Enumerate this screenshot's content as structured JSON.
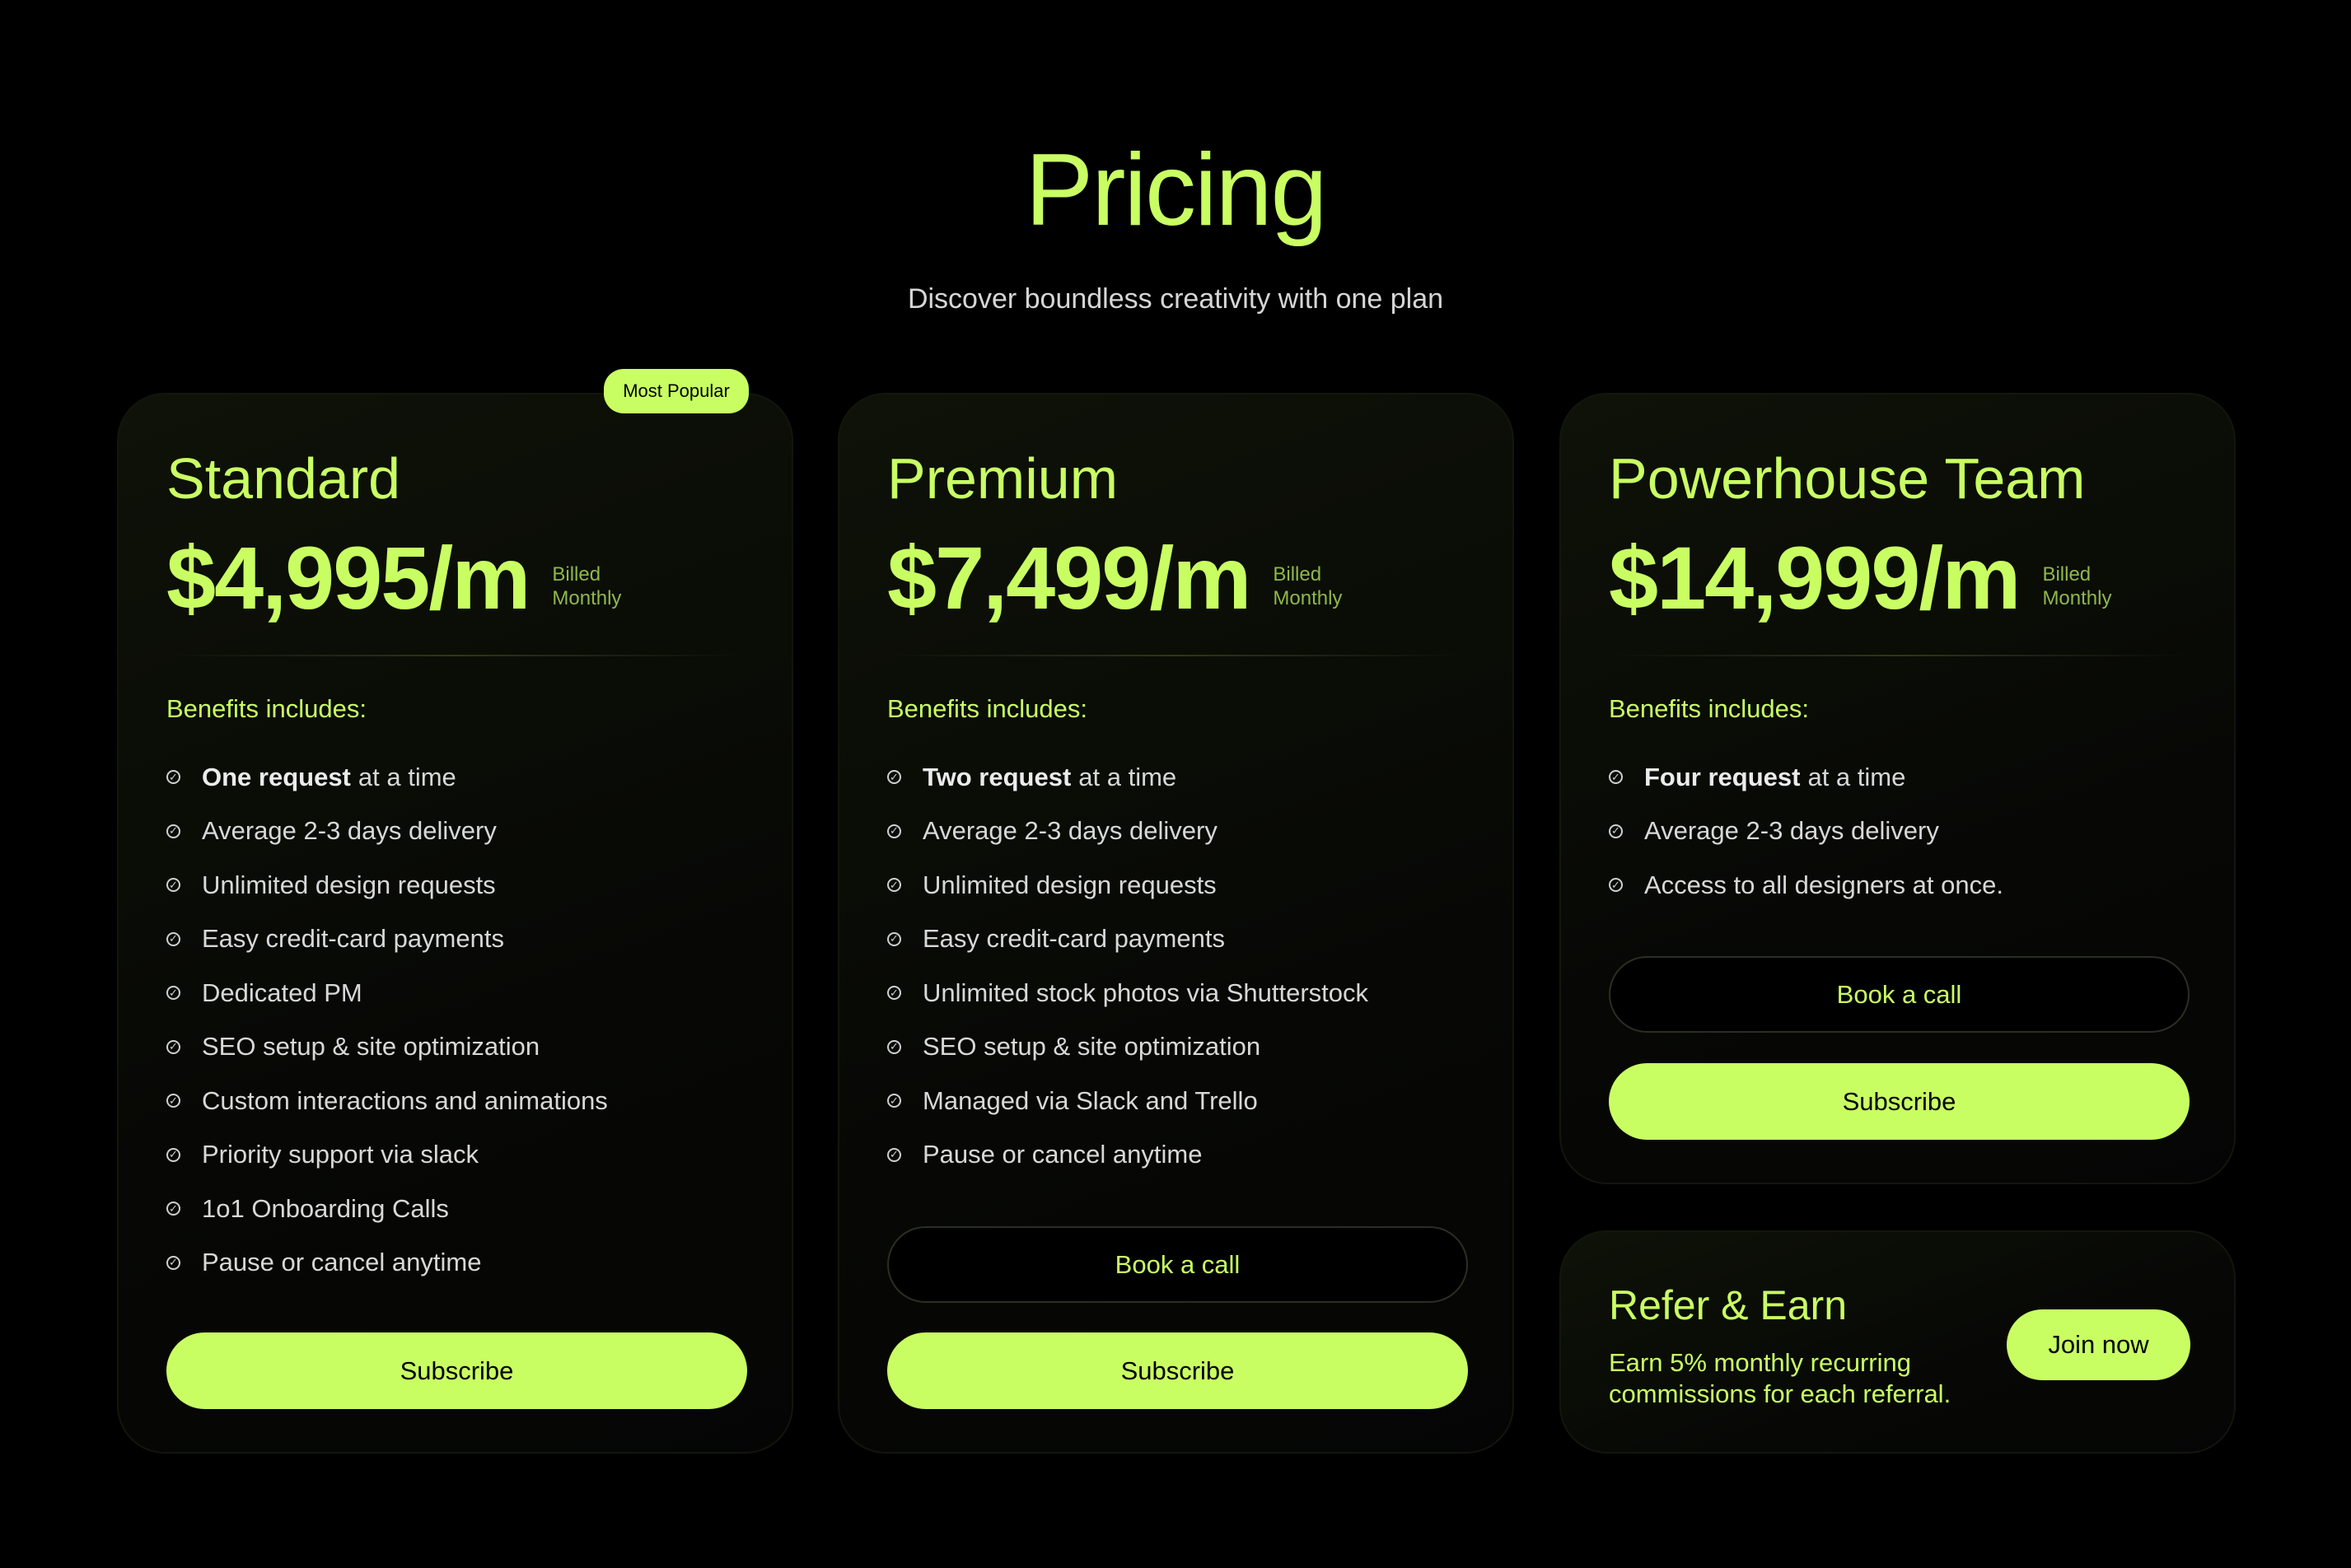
{
  "header": {
    "title": "Pricing",
    "subtitle": "Discover boundless creativity with one plan"
  },
  "colors": {
    "accent": "#c9fe63",
    "background": "#000000"
  },
  "plans": [
    {
      "name": "Standard",
      "price": "$4,995/m",
      "billed_line1": "Billed",
      "billed_line2": "Monthly",
      "badge": "Most Popular",
      "benefits_label": "Benefits includes:",
      "benefits": [
        {
          "bold": "One request",
          "text": "at a time"
        },
        {
          "bold": "",
          "text": "Average 2-3 days delivery"
        },
        {
          "bold": "",
          "text": "Unlimited design requests"
        },
        {
          "bold": "",
          "text": "Easy credit-card payments"
        },
        {
          "bold": "",
          "text": "Dedicated PM"
        },
        {
          "bold": "",
          "text": "SEO setup & site optimization"
        },
        {
          "bold": "",
          "text": "Custom interactions and animations"
        },
        {
          "bold": "",
          "text": "Priority support via slack"
        },
        {
          "bold": "",
          "text": "1o1 Onboarding Calls"
        },
        {
          "bold": "",
          "text": "Pause or cancel anytime"
        }
      ],
      "subscribe_label": "Subscribe"
    },
    {
      "name": "Premium",
      "price": "$7,499/m",
      "billed_line1": "Billed",
      "billed_line2": "Monthly",
      "benefits_label": "Benefits includes:",
      "benefits": [
        {
          "bold": "Two request",
          "text": "at a time"
        },
        {
          "bold": "",
          "text": "Average 2-3 days delivery"
        },
        {
          "bold": "",
          "text": "Unlimited design requests"
        },
        {
          "bold": "",
          "text": "Easy credit-card payments"
        },
        {
          "bold": "",
          "text": "Unlimited stock photos via Shutterstock"
        },
        {
          "bold": "",
          "text": "SEO setup & site optimization"
        },
        {
          "bold": "",
          "text": "Managed via Slack and Trello"
        },
        {
          "bold": "",
          "text": "Pause or cancel anytime"
        }
      ],
      "book_label": "Book a call",
      "subscribe_label": "Subscribe"
    },
    {
      "name": "Powerhouse Team",
      "price": "$14,999/m",
      "billed_line1": "Billed",
      "billed_line2": "Monthly",
      "benefits_label": "Benefits includes:",
      "benefits": [
        {
          "bold": "Four request",
          "text": "at a time"
        },
        {
          "bold": "",
          "text": "Average 2-3 days delivery"
        },
        {
          "bold": "",
          "text": "Access to all designers at once."
        }
      ],
      "book_label": "Book a call",
      "subscribe_label": "Subscribe"
    }
  ],
  "refer": {
    "title": "Refer & Earn",
    "text": "Earn 5% monthly recurring commissions for each referral.",
    "button_label": "Join now"
  }
}
